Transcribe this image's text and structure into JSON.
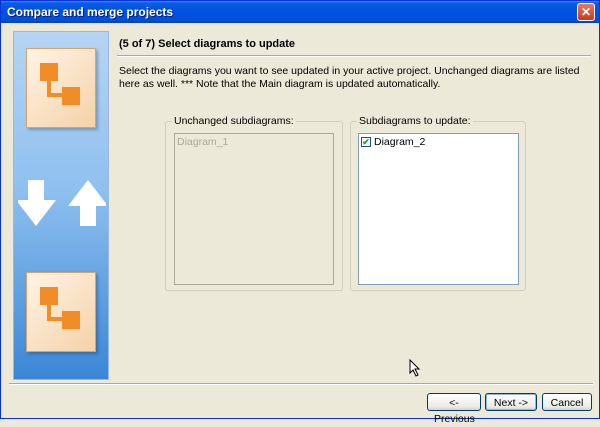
{
  "window": {
    "title": "Compare and merge projects",
    "close_glyph": "✕"
  },
  "wizard": {
    "step_header": "(5 of 7) Select diagrams to update",
    "description": "Select the diagrams you want to see updated in your active project. Unchanged diagrams are listed here as well.  *** Note that the Main diagram is updated automatically."
  },
  "unchanged": {
    "label": "Unchanged subdiagrams:",
    "items": [
      "Diagram_1"
    ]
  },
  "update": {
    "label": "Subdiagrams to update:",
    "items": [
      {
        "label": "Diagram_2",
        "checked": true
      }
    ]
  },
  "buttons": {
    "previous": "<- Previous",
    "next": "Next ->",
    "cancel": "Cancel"
  },
  "icons": {
    "side_arrows": "down-up-arrows-icon",
    "diagram": "diagram-icon"
  }
}
